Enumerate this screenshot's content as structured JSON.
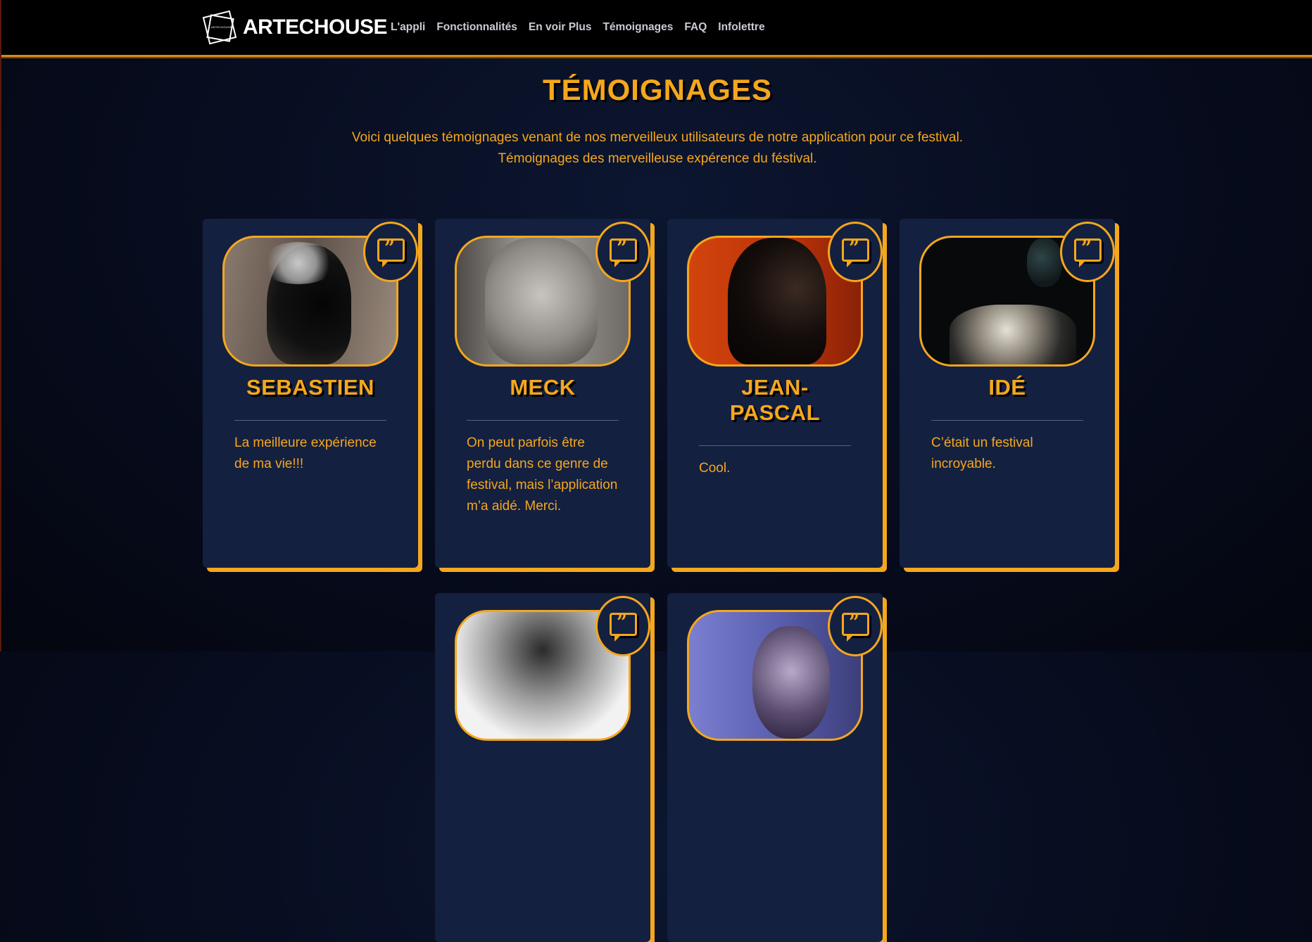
{
  "header": {
    "brand": "ARTECHOUSE",
    "logo_small_text": "ARTECHOUSE",
    "nav": [
      "L'appli",
      "Fonctionnalités",
      "En voir Plus",
      "Témoignages",
      "FAQ",
      "Infolettre"
    ]
  },
  "section": {
    "title": "TÉMOIGNAGES",
    "intro_line1": "Voici quelques témoignages venant de nos merveilleux utilisateurs de notre application pour ce festival.",
    "intro_line2": "Témoignages des merveilleuse expérence du féstival."
  },
  "testimonials": [
    {
      "name": "SEBASTIEN",
      "text": "La meilleure expérience de ma vie!!!",
      "photo_bg": "#7a6a5e"
    },
    {
      "name": "MECK",
      "text": "On peut parfois être perdu dans ce genre de festival, mais l’application m’a aidé. Merci.",
      "photo_bg": "#8d8a86"
    },
    {
      "name": "JEAN-PASCAL",
      "text": "Cool.",
      "photo_bg": "#c23a0a"
    },
    {
      "name": "IDÉ",
      "text": "C’était un festival incroyable.",
      "photo_bg": "#0a0c0f"
    },
    {
      "name": "",
      "text": "",
      "photo_bg": "#d8d8d8"
    },
    {
      "name": "",
      "text": "",
      "photo_bg": "#6f74b8"
    }
  ],
  "colors": {
    "accent": "#f5a71c",
    "card": "#142040",
    "background": "#070c1e"
  }
}
